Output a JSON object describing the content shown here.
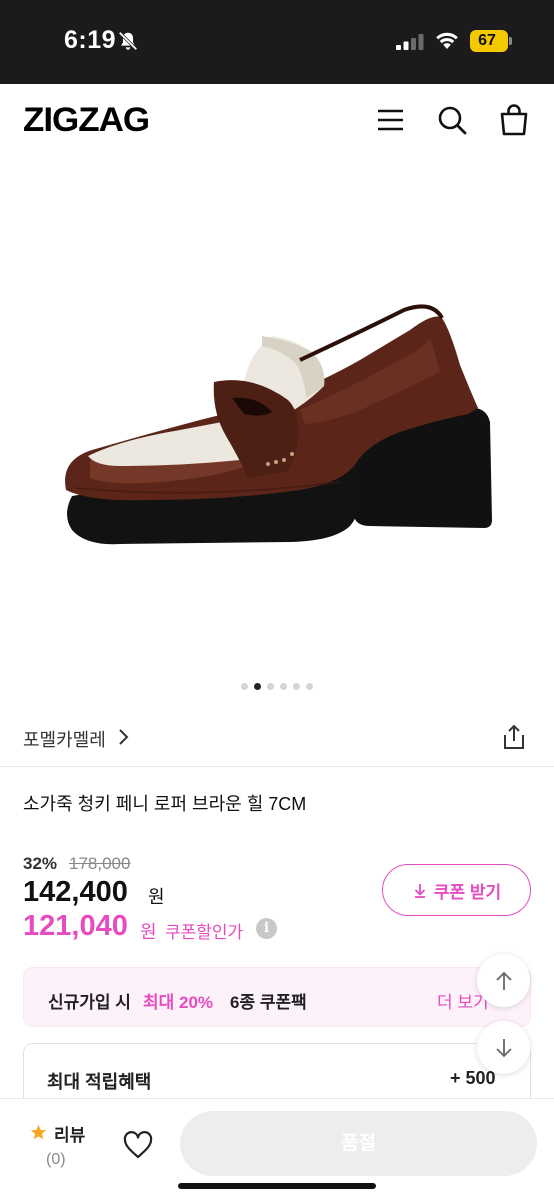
{
  "status_bar": {
    "time": "6:19",
    "battery": "67"
  },
  "header": {
    "logo": "ZIGZAG"
  },
  "gallery": {
    "image_count": 6,
    "active_index": 1
  },
  "product": {
    "brand": "포멜카멜레",
    "name": "소가죽 청키 페니 로퍼 브라운 힐 7CM",
    "discount_rate": "32%",
    "original_price": "178,000",
    "sale_price": "142,400",
    "sale_unit": "원",
    "coupon_price": "121,040",
    "coupon_unit": "원",
    "coupon_label": "쿠폰할인가",
    "info_glyph": "i"
  },
  "coupon_button": {
    "label": "쿠폰 받기"
  },
  "promo": {
    "text_a": "신규가입 시",
    "text_b": "최대 20%",
    "text_c": "6종 쿠폰팩",
    "more": "더 보기"
  },
  "benefit": {
    "title": "최대 적립혜택",
    "value": "+ 500"
  },
  "bottom_bar": {
    "review_label": "리뷰",
    "review_count": "(0)",
    "buy_label": "품절"
  },
  "colors": {
    "accent": "#e64cc0",
    "status_bar": "#1b1b1d",
    "battery": "#f5c900",
    "star": "#f5a623"
  }
}
